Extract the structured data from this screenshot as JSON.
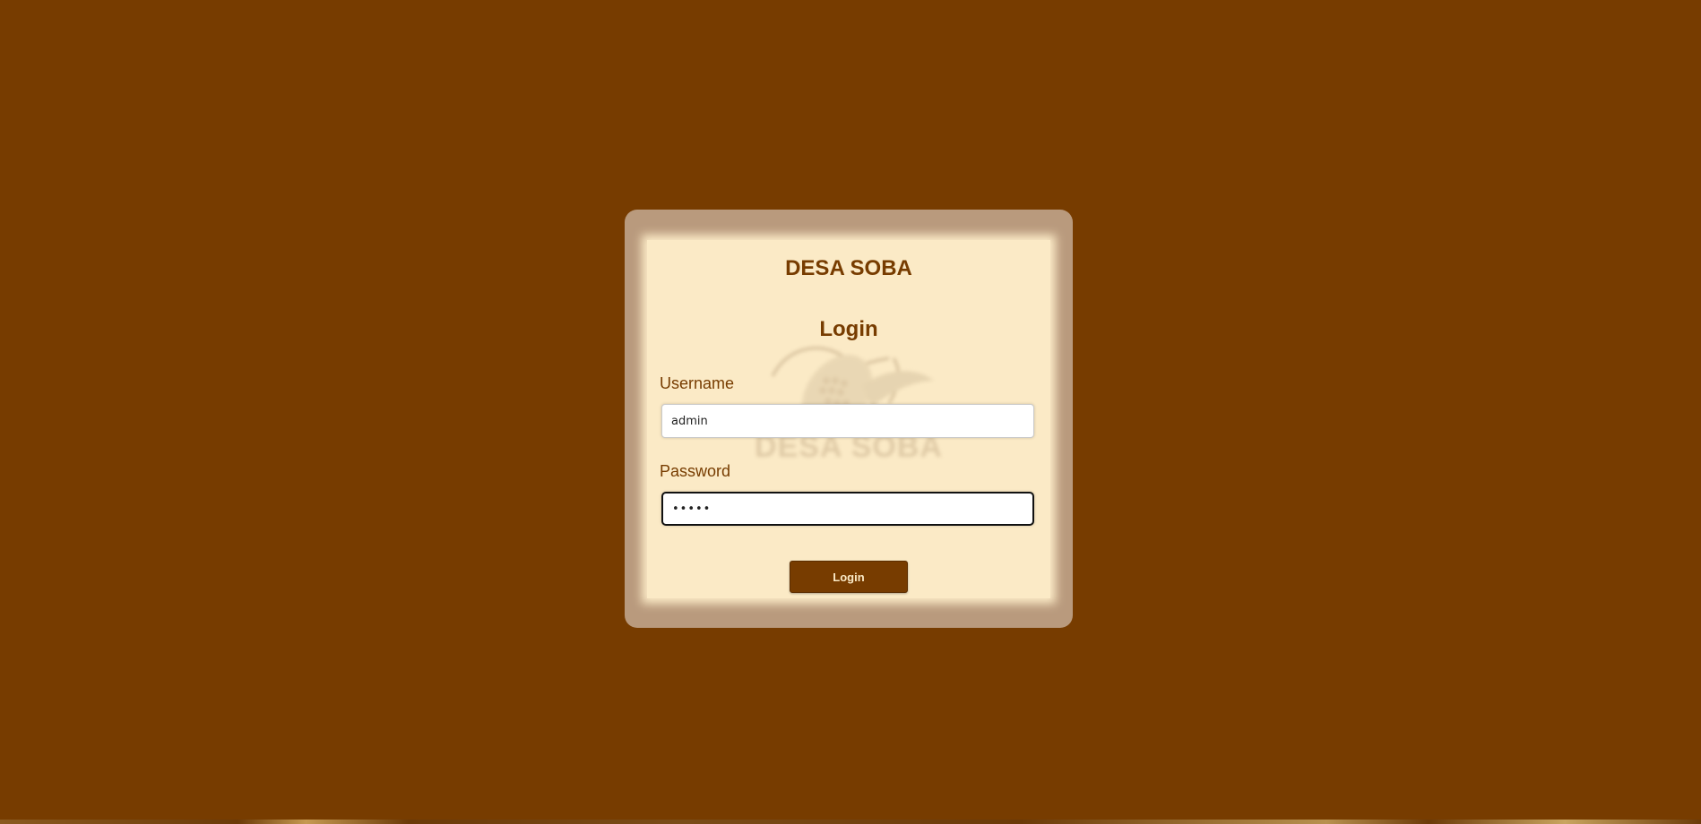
{
  "colors": {
    "background": "#773c00",
    "frame": "#b99a7d",
    "card": "#fbeac6",
    "accent": "#773c00",
    "button_text": "#fbeac6"
  },
  "login": {
    "brand": "DESA SOBA",
    "heading": "Login",
    "watermark_text": "DESA SOBA",
    "watermark_icon": "corn-icon",
    "username_label": "Username",
    "username_value": "admin",
    "password_label": "Password",
    "password_value": "•••••",
    "button_label": "Login"
  }
}
